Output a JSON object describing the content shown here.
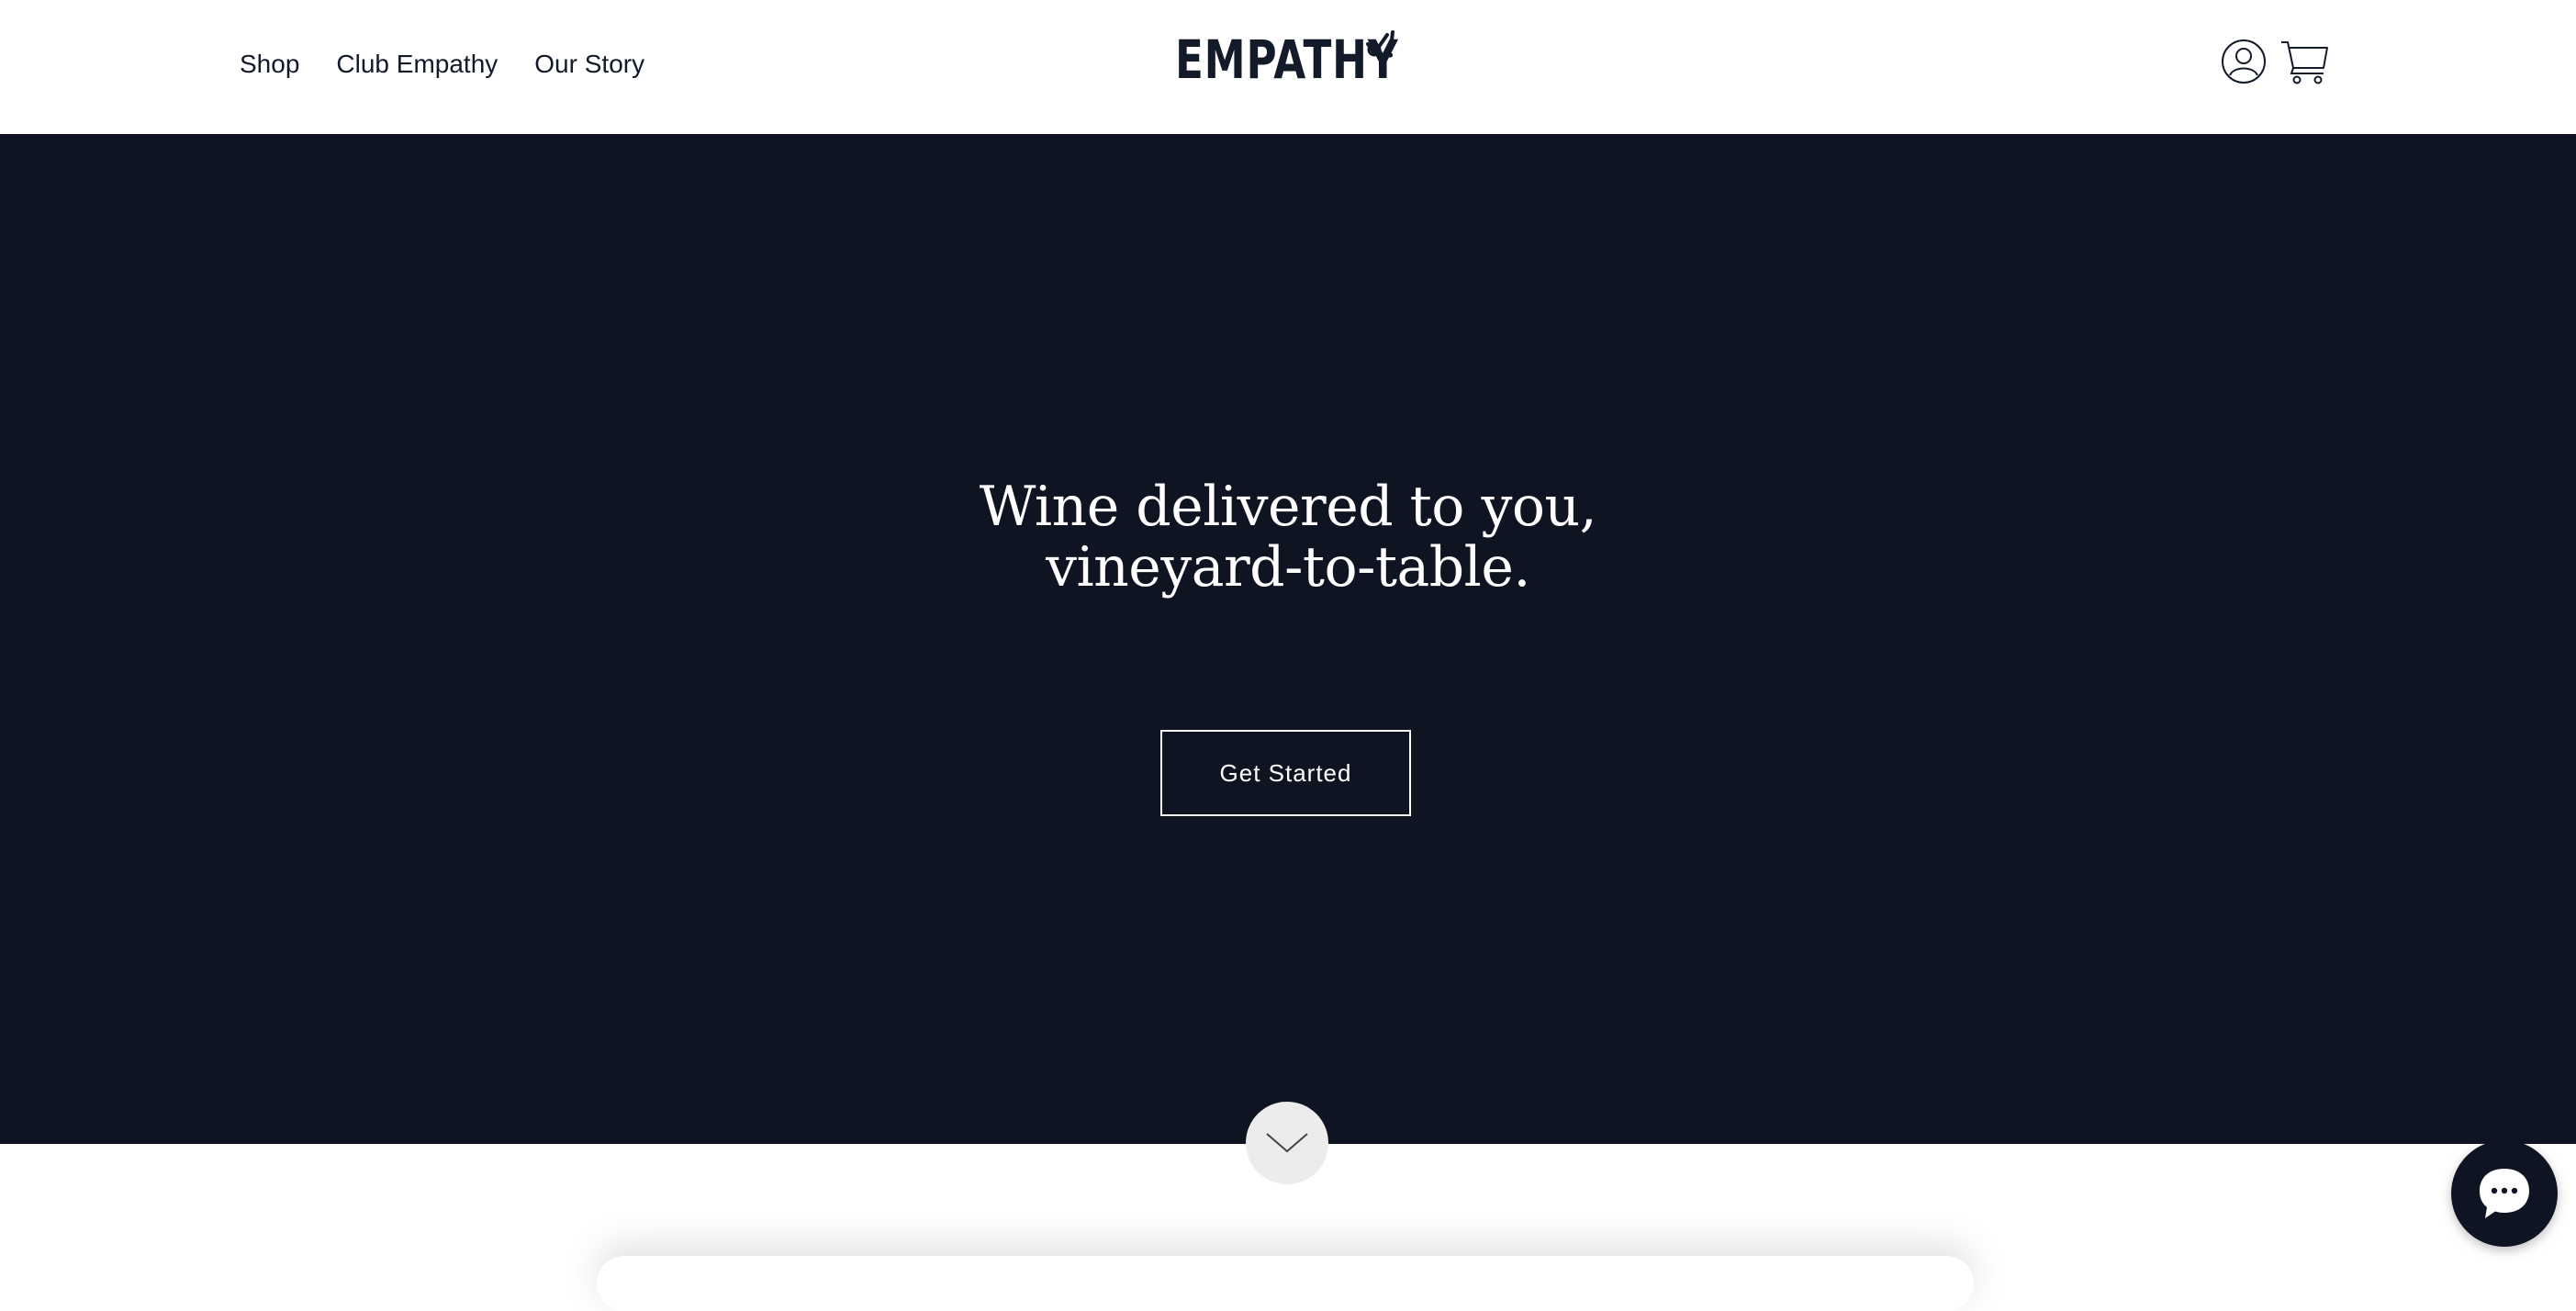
{
  "nav": {
    "items": [
      {
        "label": "Shop"
      },
      {
        "label": "Club Empathy"
      },
      {
        "label": "Our Story"
      }
    ]
  },
  "brand": {
    "name": "EMPATHY",
    "color": "#131a2a"
  },
  "header_icons": [
    "account-icon",
    "cart-icon"
  ],
  "hero": {
    "title_line1": "Wine delivered to you,",
    "title_line2": "vineyard-to-table.",
    "cta_label": "Get Started",
    "background": "#0f1422"
  },
  "scroll_icon": "chevron-down-icon",
  "chat_icon": "chat-icon"
}
